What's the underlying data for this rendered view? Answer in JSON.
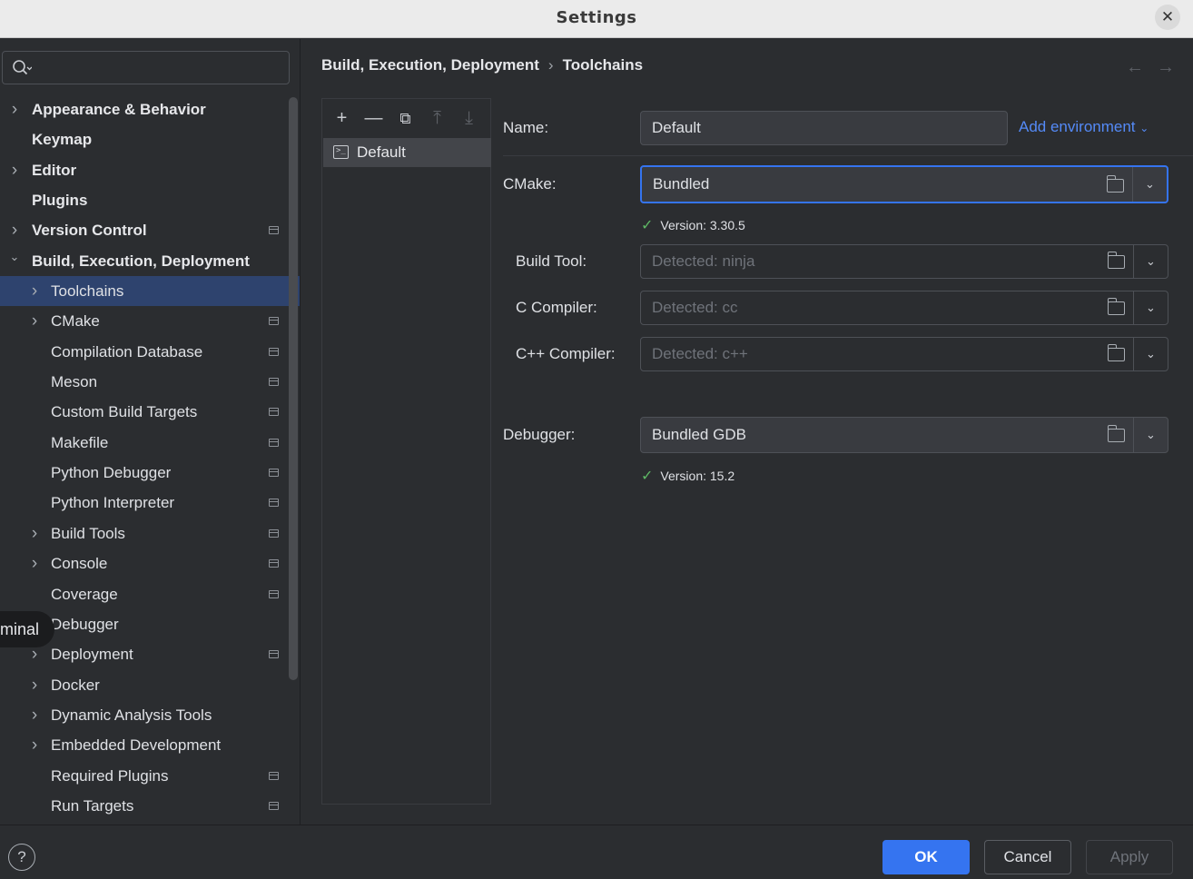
{
  "window": {
    "title": "Settings",
    "close_glyph": "✕"
  },
  "search": {
    "value": ""
  },
  "sidebar": {
    "items": [
      {
        "label": "Appearance & Behavior",
        "level": 0,
        "expandable": true,
        "expanded": false,
        "bold": true,
        "project_icon": false
      },
      {
        "label": "Keymap",
        "level": 0,
        "expandable": false,
        "bold": true,
        "project_icon": false
      },
      {
        "label": "Editor",
        "level": 0,
        "expandable": true,
        "expanded": false,
        "bold": true,
        "project_icon": false
      },
      {
        "label": "Plugins",
        "level": 0,
        "expandable": false,
        "bold": true,
        "project_icon": false
      },
      {
        "label": "Version Control",
        "level": 0,
        "expandable": true,
        "expanded": false,
        "bold": true,
        "project_icon": true
      },
      {
        "label": "Build, Execution, Deployment",
        "level": 0,
        "expandable": true,
        "expanded": true,
        "bold": true,
        "project_icon": false
      },
      {
        "label": "Toolchains",
        "level": 1,
        "expandable": true,
        "expanded": false,
        "selected": true,
        "project_icon": false
      },
      {
        "label": "CMake",
        "level": 1,
        "expandable": true,
        "expanded": false,
        "project_icon": true
      },
      {
        "label": "Compilation Database",
        "level": 1,
        "expandable": false,
        "project_icon": true
      },
      {
        "label": "Meson",
        "level": 1,
        "expandable": false,
        "project_icon": true
      },
      {
        "label": "Custom Build Targets",
        "level": 1,
        "expandable": false,
        "project_icon": true
      },
      {
        "label": "Makefile",
        "level": 1,
        "expandable": false,
        "project_icon": true
      },
      {
        "label": "Python Debugger",
        "level": 1,
        "expandable": false,
        "project_icon": true
      },
      {
        "label": "Python Interpreter",
        "level": 1,
        "expandable": false,
        "project_icon": true
      },
      {
        "label": "Build Tools",
        "level": 1,
        "expandable": true,
        "expanded": false,
        "project_icon": true
      },
      {
        "label": "Console",
        "level": 1,
        "expandable": true,
        "expanded": false,
        "project_icon": true
      },
      {
        "label": "Coverage",
        "level": 1,
        "expandable": false,
        "project_icon": true
      },
      {
        "label": "Debugger",
        "level": 1,
        "expandable": false,
        "project_icon": false
      },
      {
        "label": "Deployment",
        "level": 1,
        "expandable": true,
        "expanded": false,
        "project_icon": true
      },
      {
        "label": "Docker",
        "level": 1,
        "expandable": true,
        "expanded": false,
        "project_icon": false
      },
      {
        "label": "Dynamic Analysis Tools",
        "level": 1,
        "expandable": true,
        "expanded": false,
        "project_icon": false
      },
      {
        "label": "Embedded Development",
        "level": 1,
        "expandable": true,
        "expanded": false,
        "project_icon": false
      },
      {
        "label": "Required Plugins",
        "level": 1,
        "expandable": false,
        "project_icon": true
      },
      {
        "label": "Run Targets",
        "level": 1,
        "expandable": false,
        "project_icon": true
      }
    ],
    "overlay_tooltip": "minal"
  },
  "breadcrumb": {
    "parent": "Build, Execution, Deployment",
    "separator": "›",
    "current": "Toolchains"
  },
  "nav": {
    "back": "←",
    "forward": "→"
  },
  "toolchains": {
    "toolbar": {
      "add": "+",
      "remove": "—",
      "copy": "⧉",
      "move_up": "⤒",
      "move_down": "⤓"
    },
    "items": [
      {
        "label": "Default",
        "selected": true
      }
    ]
  },
  "form": {
    "name": {
      "label": "Name:",
      "value": "Default"
    },
    "add_environment": "Add environment",
    "cmake": {
      "label": "CMake:",
      "value": "Bundled",
      "status": "Version: 3.30.5"
    },
    "build_tool": {
      "label": "Build Tool:",
      "placeholder": "Detected: ninja"
    },
    "c_compiler": {
      "label": "C Compiler:",
      "placeholder": "Detected: cc"
    },
    "cpp_compiler": {
      "label": "C++ Compiler:",
      "placeholder": "Detected: c++"
    },
    "debugger": {
      "label": "Debugger:",
      "value": "Bundled GDB",
      "status": "Version: 15.2"
    }
  },
  "footer": {
    "help": "?",
    "ok": "OK",
    "cancel": "Cancel",
    "apply": "Apply"
  },
  "colors": {
    "accent": "#3574f0",
    "selection": "#2e436e",
    "link": "#548af7",
    "success": "#5fb865",
    "background": "#2b2d30"
  }
}
